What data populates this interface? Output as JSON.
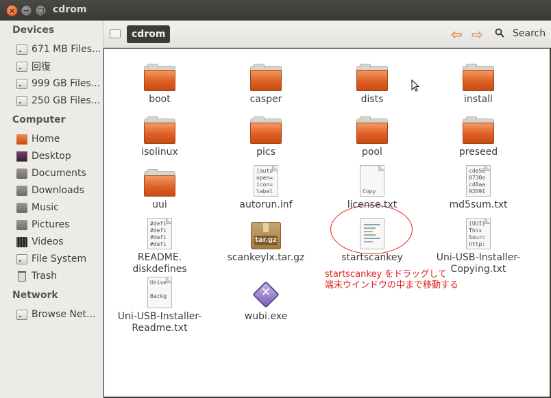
{
  "window": {
    "title": "cdrom",
    "buttons": {
      "close": "×",
      "minimize": "−",
      "maximize": "□"
    }
  },
  "sidebar": {
    "sections": [
      {
        "heading": "Devices",
        "items": [
          {
            "label": "671 MB Files...",
            "icon": "drive-icon"
          },
          {
            "label": "回復",
            "icon": "drive-icon"
          },
          {
            "label": "999 GB Files...",
            "icon": "drive-icon"
          },
          {
            "label": "250 GB Files...",
            "icon": "drive-icon"
          }
        ]
      },
      {
        "heading": "Computer",
        "items": [
          {
            "label": "Home",
            "icon": "home-icon"
          },
          {
            "label": "Desktop",
            "icon": "desktop-icon"
          },
          {
            "label": "Documents",
            "icon": "folder-icon"
          },
          {
            "label": "Downloads",
            "icon": "folder-icon"
          },
          {
            "label": "Music",
            "icon": "folder-icon"
          },
          {
            "label": "Pictures",
            "icon": "folder-icon"
          },
          {
            "label": "Videos",
            "icon": "video-icon"
          },
          {
            "label": "File System",
            "icon": "drive-icon"
          },
          {
            "label": "Trash",
            "icon": "trash-icon"
          }
        ]
      },
      {
        "heading": "Network",
        "items": [
          {
            "label": "Browse Net...",
            "icon": "drive-icon"
          }
        ]
      }
    ]
  },
  "toolbar": {
    "breadcrumb": "cdrom",
    "back": "⇦",
    "forward": "⇨",
    "search_label": "Search"
  },
  "files": [
    {
      "name": "boot",
      "type": "folder"
    },
    {
      "name": "casper",
      "type": "folder"
    },
    {
      "name": "dists",
      "type": "folder"
    },
    {
      "name": "install",
      "type": "folder"
    },
    {
      "name": "isolinux",
      "type": "folder"
    },
    {
      "name": "pics",
      "type": "folder"
    },
    {
      "name": "pool",
      "type": "folder"
    },
    {
      "name": "preseed",
      "type": "folder"
    },
    {
      "name": "uui",
      "type": "folder"
    },
    {
      "name": "autorun.inf",
      "type": "text",
      "preview": "[auto\nopen=\nicon=\nlabel"
    },
    {
      "name": "license.txt",
      "type": "text",
      "preview": "\n\n\nCopy"
    },
    {
      "name": "md5sum.txt",
      "type": "text",
      "preview": "cde56\n0730e\ncd8aa\n92091"
    },
    {
      "name": "README.\ndiskdefines",
      "type": "text",
      "preview": "#defi\n#defi\n#defi\n#defi"
    },
    {
      "name": "scankeylx.tar.gz",
      "type": "archive",
      "tag": "tar.gz"
    },
    {
      "name": "startscankey",
      "type": "script"
    },
    {
      "name": "Uni-USB-Installer-\nCopying.txt",
      "type": "text",
      "preview": "(UUI)\nThis\nSourc\nhttp:"
    },
    {
      "name": "Uni-USB-Installer-\nReadme.txt",
      "type": "text",
      "preview": "Unive\n\nBackg"
    },
    {
      "name": "wubi.exe",
      "type": "exe"
    }
  ],
  "annotation": {
    "line1": "startscankey をドラッグして",
    "line2": "端末ウインドウの中まで移動する",
    "color": "#e0201a"
  },
  "colors": {
    "accent": "#dd5f24",
    "titlebar": "#3c3b37"
  }
}
